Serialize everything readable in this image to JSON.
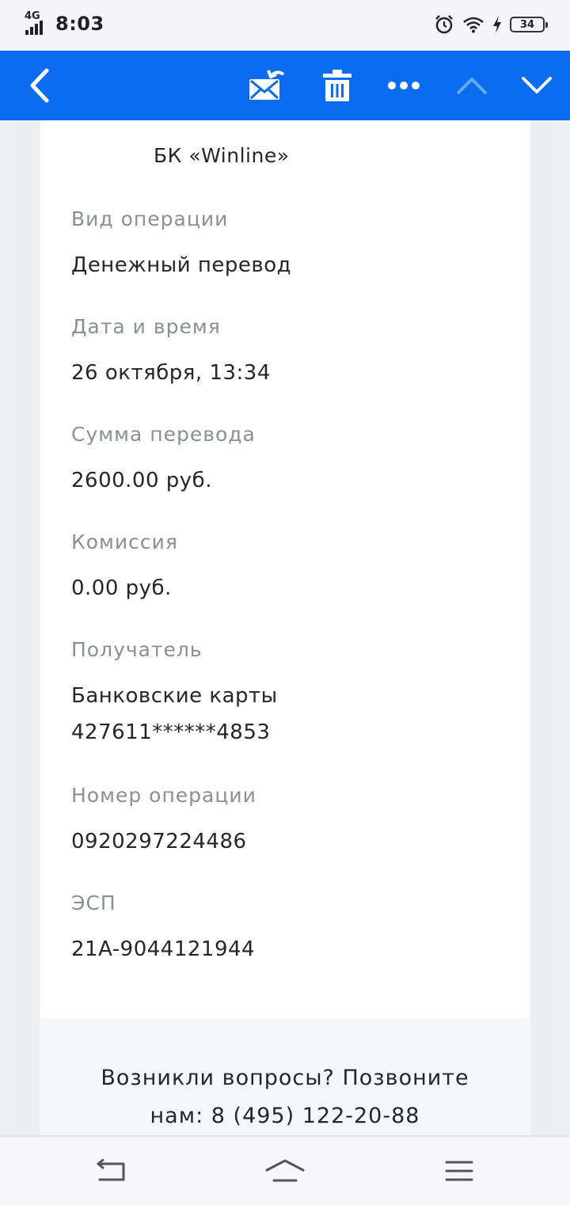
{
  "status_bar": {
    "network": "4G",
    "time": "8:03",
    "battery": "34",
    "icons": [
      "signal-icon",
      "alarm-icon",
      "wifi-icon",
      "charging-icon",
      "battery-icon"
    ]
  },
  "toolbar": {
    "background": "#0a6cf0",
    "icons": [
      "back-icon",
      "mark-unread-icon",
      "delete-icon",
      "more-icon",
      "previous-message-icon",
      "next-message-icon"
    ]
  },
  "receipt": {
    "sender": "БК «Winline»",
    "fields": [
      {
        "label": "Вид операции",
        "value": "Денежный перевод"
      },
      {
        "label": "Дата и время",
        "value": "26 октября, 13:34"
      },
      {
        "label": "Сумма перевода",
        "value": "2600.00 руб."
      },
      {
        "label": "Комиссия",
        "value": "0.00 руб."
      },
      {
        "label": "Получатель",
        "value": "Банковские карты",
        "value2": "427611******4853"
      },
      {
        "label": "Номер операции",
        "value": "0920297224486"
      },
      {
        "label": "ЭСП",
        "value": "21A-9044121944"
      }
    ]
  },
  "footer": {
    "line1": "Возникли вопросы? Позвоните",
    "line2": "нам: 8 (495) 122-20-88"
  },
  "nav_bar": {
    "icons": [
      "back-nav-icon",
      "home-icon",
      "menu-icon"
    ]
  }
}
